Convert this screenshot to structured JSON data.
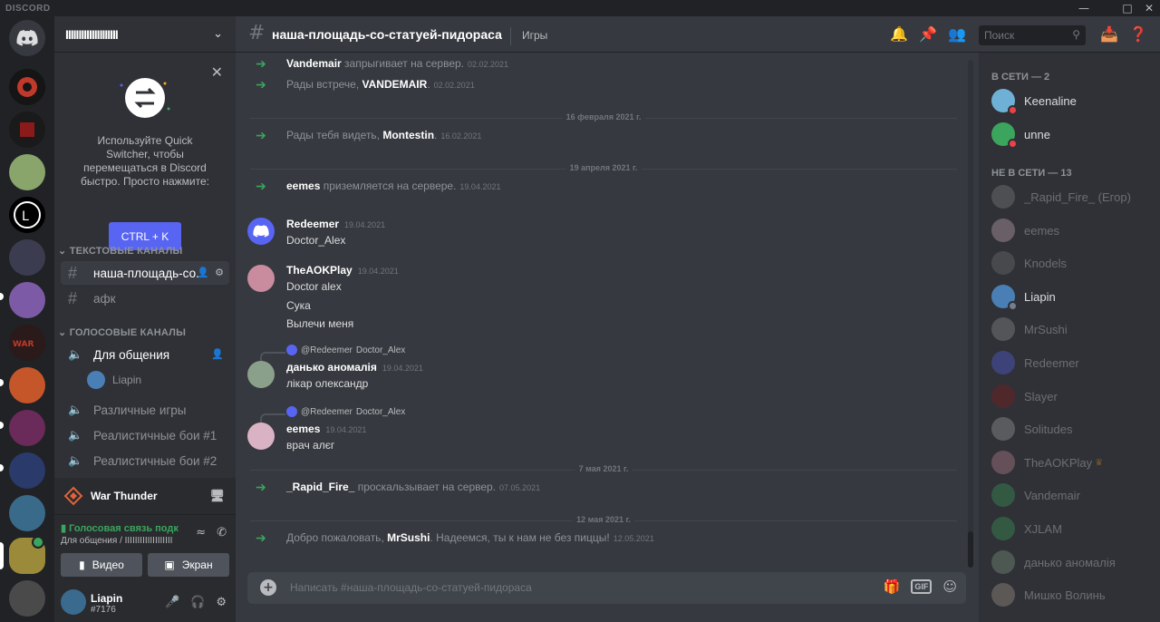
{
  "app": {
    "brand": "DISCORD"
  },
  "server": {
    "name": "IIIIIIIIIIIIIIIIIIII"
  },
  "quick_switcher": {
    "text": "Используйте Quick Switcher, чтобы перемещаться в Discord быстро. Просто нажмите:",
    "shortcut": "CTRL + K"
  },
  "categories": {
    "text": "ТЕКСТОВЫЕ КАНАЛЫ",
    "voice": "ГОЛОСОВЫЕ КАНАЛЫ"
  },
  "text_channels": [
    {
      "name": "наша-площадь-со..."
    },
    {
      "name": "афк"
    }
  ],
  "voice_channels": [
    {
      "name": "Для общения"
    },
    {
      "name": "Различные игры"
    },
    {
      "name": "Реалистичные бои #1"
    },
    {
      "name": "Реалистичные бои #2"
    }
  ],
  "voice_users": [
    {
      "name": "Liapin"
    }
  ],
  "activity": {
    "game": "War Thunder"
  },
  "voice_status": {
    "title": "Голосовая связь подк",
    "sub": "Для общения / IIIIIIIIIIIIIIIIIII",
    "video": "Видео",
    "screen": "Экран"
  },
  "user": {
    "name": "Liapin",
    "tag": "#7176"
  },
  "channel": {
    "name": "наша-площадь-со-статуей-пидораса",
    "topic": "Игры"
  },
  "search": {
    "placeholder": "Поиск"
  },
  "messages": {
    "s1": {
      "user": "Vandemair",
      "text": " запрыгивает на сервер.",
      "ts": "02.02.2021"
    },
    "s2": {
      "pre": "Рады встрече, ",
      "user": "VANDEMAIR",
      "post": ".",
      "ts": "02.02.2021"
    },
    "d1": "16 февраля 2021 г.",
    "s3": {
      "pre": "Рады тебя видеть, ",
      "user": "Montestin",
      "post": ".",
      "ts": "16.02.2021"
    },
    "d2": "19 апреля 2021 г.",
    "s4": {
      "user": "eemes",
      "text": " приземляется на сервере.",
      "ts": "19.04.2021"
    },
    "m1": {
      "author": "Redeemer",
      "ts": "19.04.2021",
      "lines": [
        "Doctor_Alex"
      ]
    },
    "m2": {
      "author": "TheAOKPlay",
      "ts": "19.04.2021",
      "lines": [
        "Doctor alex",
        "Сука",
        "Вылечи меня"
      ]
    },
    "m3": {
      "reply": "@Redeemer",
      "reply_text": "Doctor_Alex",
      "author": "данько аномалія",
      "ts": "19.04.2021",
      "lines": [
        "лікар олександр"
      ]
    },
    "m4": {
      "reply": "@Redeemer",
      "reply_text": "Doctor_Alex",
      "author": "eemes",
      "ts": "19.04.2021",
      "lines": [
        "врач алєг"
      ]
    },
    "d3": "7 мая 2021 г.",
    "s5": {
      "user": "_Rapid_Fire_",
      "text": " проскальзывает на сервер.",
      "ts": "07.05.2021"
    },
    "d4": "12 мая 2021 г.",
    "s6": {
      "pre": "Добро пожаловать, ",
      "user": "MrSushi",
      "post": ". Надеемся, ты к нам не без пиццы!",
      "ts": "12.05.2021"
    }
  },
  "composer": {
    "placeholder": "Написать #наша-площадь-со-статуей-пидораса"
  },
  "members": {
    "online_title": "В СЕТИ — 2",
    "offline_title": "НЕ В СЕТИ — 13",
    "online": [
      {
        "name": "Keenaline"
      },
      {
        "name": "unne"
      }
    ],
    "offline": [
      {
        "name": "_Rapid_Fire_ (Егор)"
      },
      {
        "name": "eemes"
      },
      {
        "name": "Knodels"
      },
      {
        "name": "Liapin"
      },
      {
        "name": "MrSushi"
      },
      {
        "name": "Redeemer"
      },
      {
        "name": "Slayer"
      },
      {
        "name": "Solitudes"
      },
      {
        "name": "TheAOKPlay"
      },
      {
        "name": "Vandemair"
      },
      {
        "name": "XJLAM"
      },
      {
        "name": "данько аномалія"
      },
      {
        "name": "Мишко Волинь"
      }
    ]
  },
  "colors": {
    "accent": "#5865f2",
    "online": "#3ba55d",
    "dnd": "#ed4245",
    "arrow": "#3ba55d"
  }
}
